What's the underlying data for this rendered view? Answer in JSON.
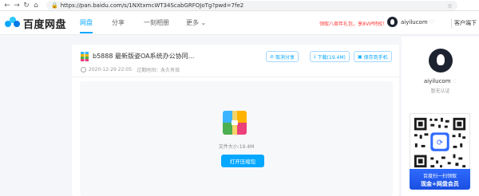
{
  "browser": {
    "url": "https://pan.baidu.com/s/1NXtxmcWT34ScabGRFOJoTg?pwd=7fe2"
  },
  "header": {
    "logo_text": "百度网盘",
    "tabs": [
      {
        "label": "网盘",
        "active": true
      },
      {
        "label": "分享",
        "active": false
      },
      {
        "label": "一刻相册",
        "active": false
      },
      {
        "label": "更多",
        "active": false
      }
    ],
    "promo_text": "领取八周年礼包，享8VIP特权！",
    "username": "aiyilucom",
    "client_label": "客户端下"
  },
  "file": {
    "title": "b5888 最新版姿OA系统办公协同...",
    "date": "2020-12-29 22:05",
    "expiry": "过期时间：永久有效",
    "size_text": "文件大小:19.4M",
    "open_label": "打开压缩包",
    "actions": {
      "cancel_share": "取消分享",
      "download": "下载(19.4M)",
      "save": "保存到手机"
    }
  },
  "sidebar": {
    "username": "aiyilucom",
    "verify_text": "暂无认证",
    "qr_line1": "百度扫一扫领取",
    "qr_line2": "现金+网盘会员"
  },
  "colors": {
    "accent": "#06a7ff",
    "promo": "#ff3333",
    "qr_band": "#2f6bff"
  }
}
